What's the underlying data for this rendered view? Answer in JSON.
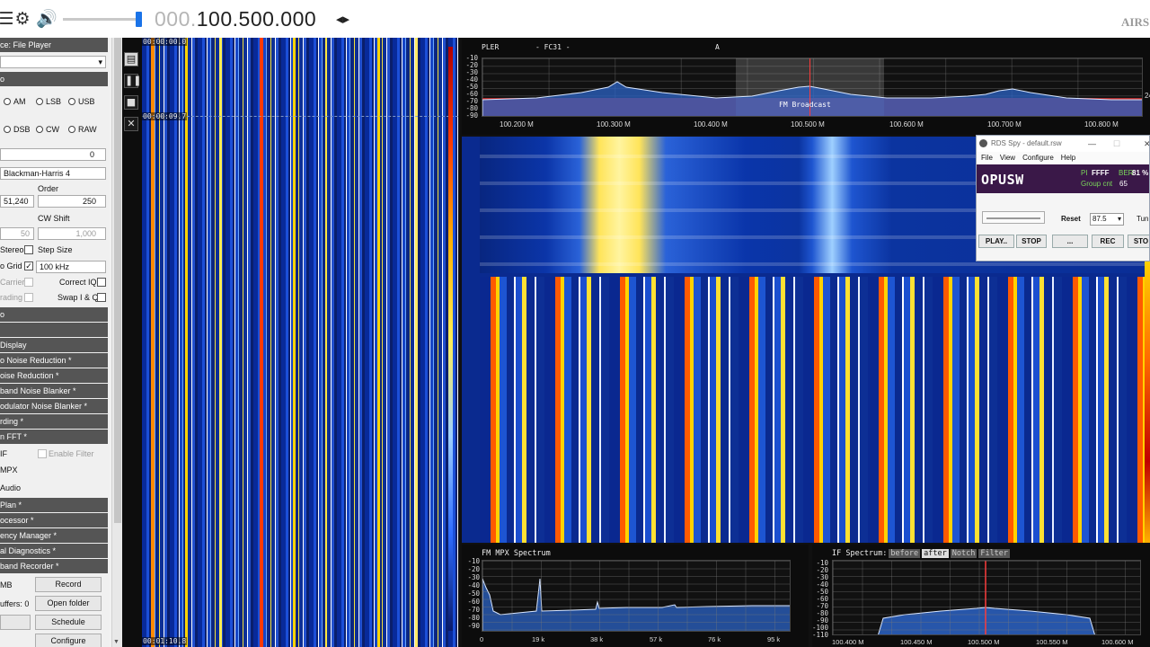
{
  "toolbar": {
    "menu_icon": "hamburger-menu-icon",
    "settings_icon": "gear-icon",
    "volume_icon": "speaker-icon",
    "freq_dim": "000.",
    "freq_main": "100.500.000",
    "freq_arrows": "◂▸",
    "logo": "AIRS"
  },
  "left_panel": {
    "source_label": "ce: File Player",
    "section_radio": "o",
    "modes_row1": [
      "AM",
      "LSB",
      "USB"
    ],
    "modes_row2": [
      "DSB",
      "CW",
      "RAW"
    ],
    "shift_value": "0",
    "window_filter": "Blackman-Harris 4",
    "order_label": "Order",
    "bandwidth_value": "51,240",
    "order_value": "250",
    "cw_shift_label": "CW Shift",
    "squelch_value": "50",
    "cw_shift_value": "1,000",
    "stereo_label": "Stereo",
    "step_size_label": "Step Size",
    "snap_grid_label": "o Grid",
    "step_value": "100 kHz",
    "carrier_label": "Carrier",
    "correct_iq_label": "Correct IQ",
    "trading_label": "rading",
    "swap_iq_label": "Swap I & Q",
    "section_blank": "o",
    "sections": [
      "Display",
      "o Noise Reduction *",
      "oise Reduction *",
      "band Noise Blanker *",
      "odulator Noise Blanker *",
      "rding *",
      "n FFT *"
    ],
    "fft_if": "IF",
    "enable_filter": "Enable Filter",
    "fft_mpx": "MPX",
    "fft_audio": "Audio",
    "sections2": [
      "Plan *",
      "ocessor *",
      "ency Manager *",
      "al Diagnostics *",
      "band Recorder *"
    ],
    "rec_size": "MB",
    "record_button": "Record",
    "buffers": "uffers: 0",
    "open_folder_button": "Open folder",
    "schedule_button": "Schedule",
    "configure_button": "Configure"
  },
  "waterfall": {
    "ts_top": "00:00:00.0",
    "ts_mid": "00:00:09.7",
    "ts_bottom": "00:01:10.8",
    "tool_icons": [
      "document-icon",
      "pause-icon",
      "stop-icon",
      "tools-icon"
    ],
    "tool_glyphs": [
      "▤",
      "❚❚",
      "■",
      "✕"
    ]
  },
  "spectrum": {
    "label_left": "PLER",
    "label_mid": "- FC31 -",
    "label_a": "A",
    "band_label": "FM Broadcast",
    "y_labels": [
      "-10",
      "-20",
      "-30",
      "-40",
      "-50",
      "-60",
      "-70",
      "-80",
      "-90"
    ],
    "x_labels": [
      "100.200 M",
      "100.300 M",
      "100.400 M",
      "100.500 M",
      "100.600 M",
      "100.700 M",
      "100.800 M"
    ],
    "right_label": "24"
  },
  "rds_spy": {
    "title": "RDS Spy - default.rsw",
    "menu": [
      "File",
      "View",
      "Configure",
      "Help"
    ],
    "ps": "OPUSW",
    "pi_label": "PI",
    "pi_value": "FFFF",
    "ber_label": "BER",
    "ber_value": "81 %",
    "group_label": "Group cnt",
    "group_value": "65",
    "reset": "Reset",
    "freq_select": "87.5",
    "tune": "Tun",
    "play": "PLAY..",
    "stop": "STOP",
    "dots": "...",
    "rec": "REC",
    "stop2": "STO"
  },
  "mpx": {
    "title": "FM MPX Spectrum",
    "y_labels": [
      "-10",
      "-20",
      "-30",
      "-40",
      "-50",
      "-60",
      "-70",
      "-80",
      "-90"
    ],
    "x_labels": [
      "0",
      "19 k",
      "38 k",
      "57 k",
      "76 k",
      "95 k"
    ]
  },
  "if_spectrum": {
    "title": "IF Spectrum:",
    "tags": [
      "before",
      "after",
      "Notch",
      "Filter"
    ],
    "y_labels": [
      "-10",
      "-20",
      "-30",
      "-40",
      "-50",
      "-60",
      "-70",
      "-80",
      "-90",
      "-100",
      "-110"
    ],
    "x_labels": [
      "100.400 M",
      "100.450 M",
      "100.500 M",
      "100.550 M",
      "100.600 M"
    ]
  }
}
